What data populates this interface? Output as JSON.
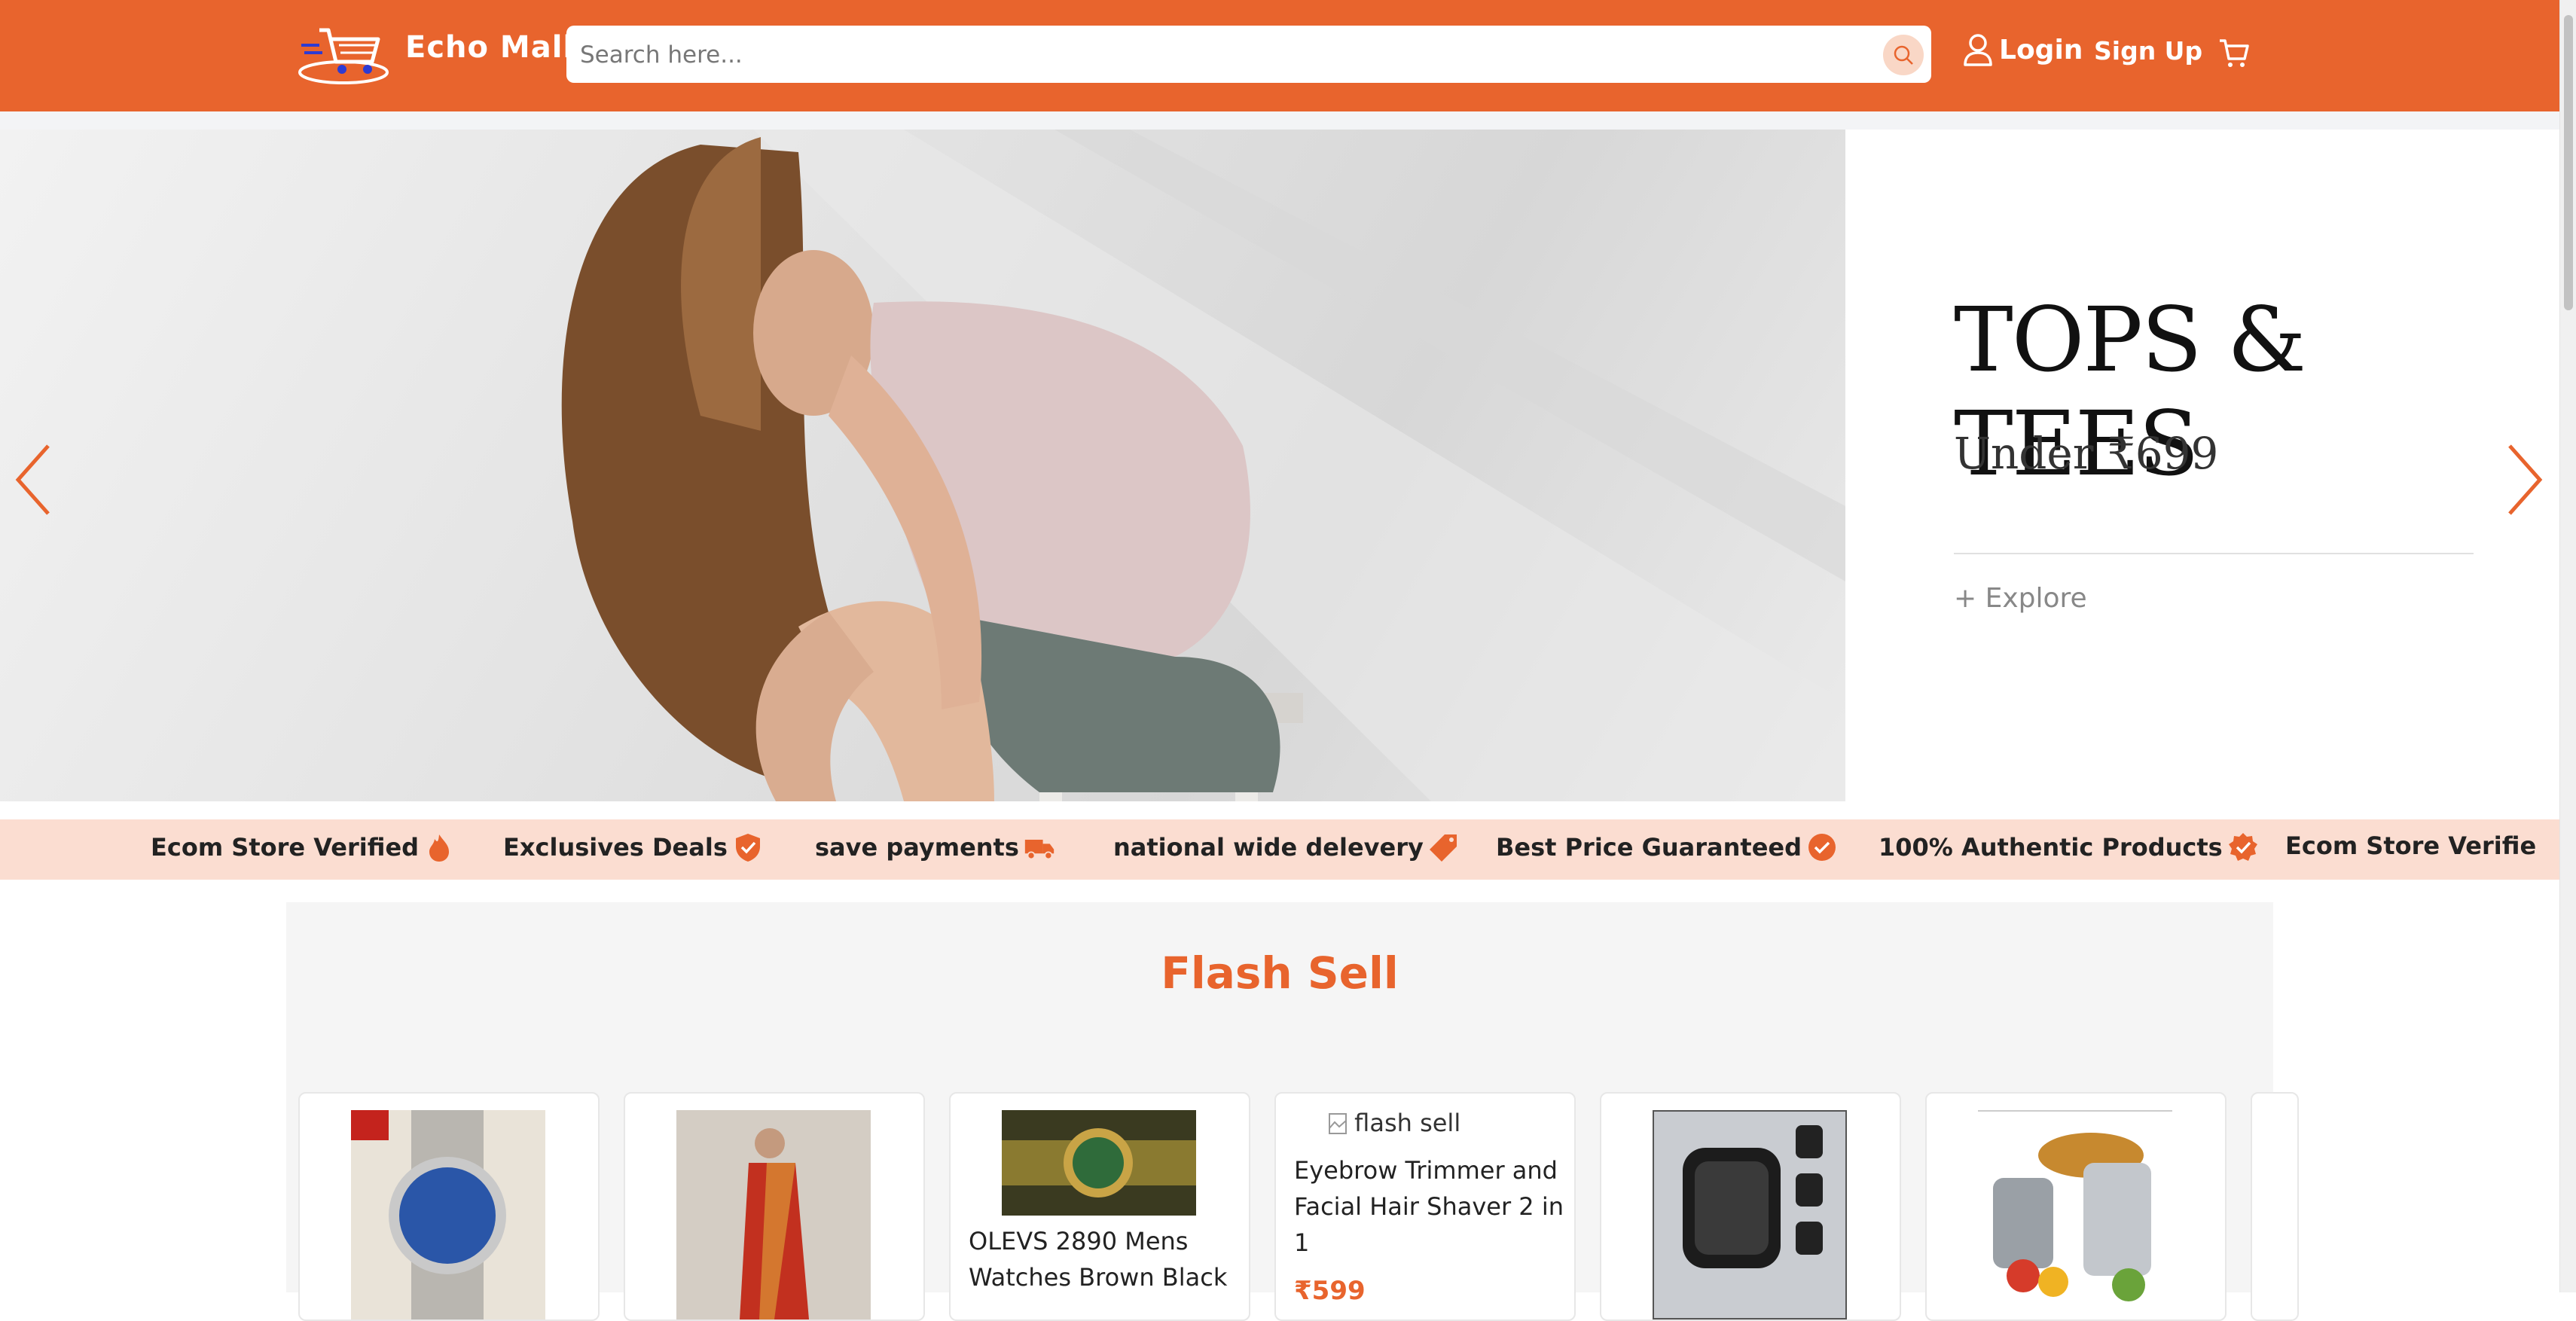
{
  "header": {
    "brand": "Echo Mall",
    "search": {
      "placeholder": "Search here..."
    },
    "login_label": "Login",
    "signup_label": "Sign Up",
    "accent_color": "#e8642d"
  },
  "hero": {
    "title": "TOPS & TEES",
    "subtitle": "Under ₹699",
    "explore_label": "+ Explore"
  },
  "marquee": {
    "items": [
      {
        "label": "Ecom Store Verified",
        "icon": "fire-icon"
      },
      {
        "label": "Exclusives Deals",
        "icon": "shield-check-icon"
      },
      {
        "label": "save payments",
        "icon": "truck-icon"
      },
      {
        "label": "national wide delevery",
        "icon": "tag-icon"
      },
      {
        "label": "Best Price Guaranteed",
        "icon": "check-circle-icon"
      },
      {
        "label": "100% Authentic Products",
        "icon": "badge-check-icon"
      },
      {
        "label": "Ecom Store Verifie",
        "icon": ""
      }
    ]
  },
  "flash": {
    "title": "Flash Sell",
    "cards": [
      {
        "name": "",
        "price": ""
      },
      {
        "name": "",
        "price": ""
      },
      {
        "name": "OLEVS 2890 Mens Watches Brown Black",
        "price": ""
      },
      {
        "broken_alt": "flash sell",
        "name": "Eyebrow Trimmer and Facial Hair Shaver 2 in 1",
        "price": "₹599"
      },
      {
        "name": "",
        "price": ""
      },
      {
        "name": "",
        "price": ""
      }
    ]
  }
}
